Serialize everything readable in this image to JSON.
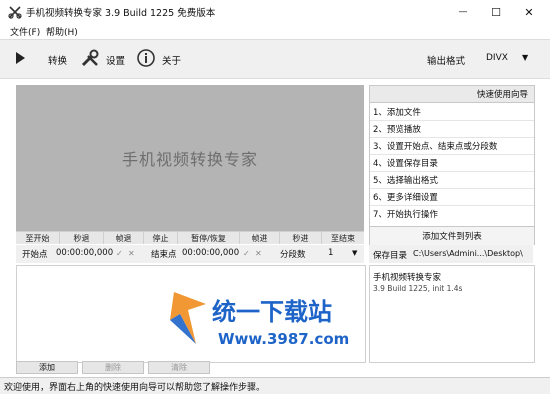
{
  "window": {
    "title": "手机视频转换专家 3.9 Build 1225 免费版本",
    "minimize_label": "—",
    "maximize_label": "☐",
    "close_label": "✕"
  },
  "menu": {
    "file": "文件(F)",
    "help": "帮助(H)"
  },
  "toolbar": {
    "convert": "转换",
    "settings": "设置",
    "about": "关于",
    "output_format_label": "输出格式",
    "output_format_value": "DIVX"
  },
  "preview": {
    "placeholder": "手机视频转换专家"
  },
  "playback": {
    "buttons": [
      "至开始",
      "秒退",
      "帧退",
      "停止",
      "暂停/恢复",
      "帧进",
      "秒进",
      "至结束"
    ]
  },
  "time": {
    "start_label": "开始点",
    "start_value": "00:00:00,000",
    "end_label": "结束点",
    "end_value": "00:00:00,000",
    "segments_label": "分段数",
    "segments_value": "1"
  },
  "guide": {
    "title": "快速使用向导",
    "steps": [
      "1、添加文件",
      "2、预览播放",
      "3、设置开始点、结束点或分段数",
      "4、设置保存目录",
      "5、选择输出格式",
      "6、更多详细设置",
      "7、开始执行操作"
    ],
    "add_to_list": "添加文件到列表"
  },
  "save": {
    "label": "保存目录",
    "path": "C:\\Users\\Admini...\\Desktop\\"
  },
  "info": {
    "name": "手机视频转换专家",
    "version": "3.9 Build 1225, init 1.4s"
  },
  "buttons": {
    "add": "添加",
    "delete": "删除",
    "clear": "清除"
  },
  "status": {
    "text": "欢迎使用，界面右上角的快速使用向导可以帮助您了解操作步骤。"
  },
  "watermark": {
    "brand": "统一下载站",
    "url": "Www.3987.com"
  },
  "colors": {
    "preview_bg": "#b4b4b4",
    "watermark_blue": "#1e64c8",
    "watermark_orange": "#f08c1e"
  }
}
